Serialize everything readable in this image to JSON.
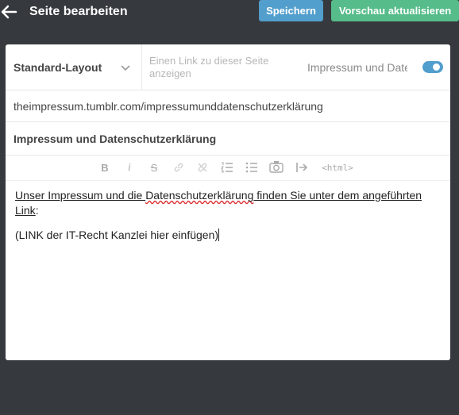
{
  "header": {
    "back_icon": "arrow-left-icon",
    "title": "Seite bearbeiten",
    "save_label": "Speichern",
    "preview_label": "Vorschau aktualisieren"
  },
  "colors": {
    "background": "#36393d",
    "save_button": "#529ecc",
    "preview_button": "#56bc8a",
    "toggle_on": "#529ecc"
  },
  "settings": {
    "layout_label": "Standard-Layout",
    "link_placeholder": "Einen Link zu dieser Seite anzeigen",
    "nav_toggle_label": "Impressum und Date",
    "nav_toggle_on": true
  },
  "page": {
    "url": "theimpressum.tumblr.com/impressumunddatenschutzerklärung",
    "title": "Impressum und Datenschutzerklärung"
  },
  "toolbar": {
    "items": [
      "bold-icon",
      "italic-icon",
      "strikethrough-icon",
      "link-icon",
      "unlink-icon",
      "ordered-list-icon",
      "bullet-list-icon",
      "camera-icon",
      "indent-icon",
      "html-icon"
    ],
    "bold": "B",
    "italic": "i",
    "strike": "S",
    "html": "<html>"
  },
  "content": {
    "line1_a": "Unser Impressum und die ",
    "line1_b": "Datenschutzerklärung",
    "line1_c": " finden Sie unter dem angeführten ",
    "line1_d": "Link",
    "line1_e": ":",
    "line2": "(LINK der IT-Recht Kanzlei hier einfügen)"
  }
}
